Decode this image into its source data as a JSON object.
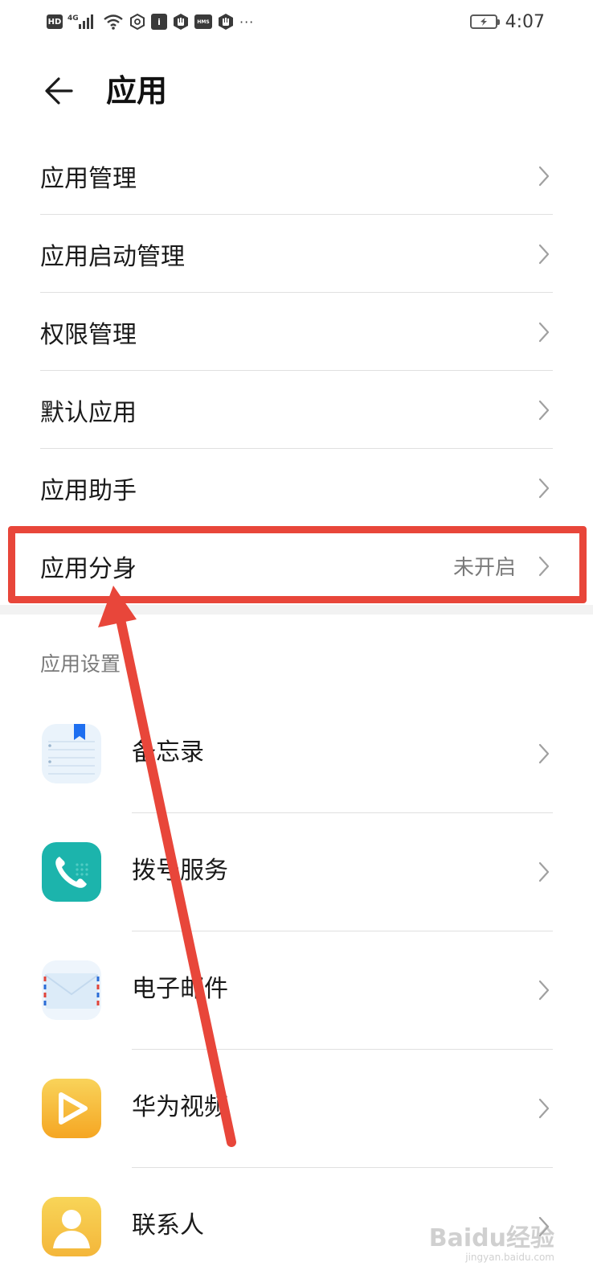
{
  "status_bar": {
    "left_icons": [
      "hd-icon",
      "4g-signal-icon",
      "wifi-icon",
      "hexagon-icon",
      "info-icon",
      "hand-icon",
      "hms-icon",
      "hand-icon",
      "more-dots-icon"
    ],
    "hd_label": "HD",
    "network_label": "4G",
    "info_label": "i",
    "hms_label": "HMS",
    "more_label": "···",
    "time": "4:07"
  },
  "header": {
    "title": "应用",
    "back_icon": "back-arrow-icon"
  },
  "menu": {
    "items": [
      {
        "label": "应用管理",
        "value": ""
      },
      {
        "label": "应用启动管理",
        "value": ""
      },
      {
        "label": "权限管理",
        "value": ""
      },
      {
        "label": "默认应用",
        "value": ""
      },
      {
        "label": "应用助手",
        "value": ""
      },
      {
        "label": "应用分身",
        "value": "未开启"
      }
    ]
  },
  "settings_section": {
    "header": "应用设置",
    "apps": [
      {
        "label": "备忘录",
        "icon": "notepad-icon"
      },
      {
        "label": "拨号服务",
        "icon": "phone-icon"
      },
      {
        "label": "电子邮件",
        "icon": "email-icon"
      },
      {
        "label": "华为视频",
        "icon": "video-play-icon"
      },
      {
        "label": "联系人",
        "icon": "contacts-icon"
      }
    ]
  },
  "colors": {
    "annotation_red": "#e8463a",
    "divider": "#e0e0e0",
    "secondary_text": "#7a7a7a",
    "phone_teal": "#1cb4ac",
    "video_yellow": "#f7c948",
    "contacts_yellow": "#f6c544",
    "notepad_blue": "#1e6ff0"
  },
  "watermark": {
    "main": "Baidu经验",
    "sub": "jingyan.baidu.com"
  }
}
